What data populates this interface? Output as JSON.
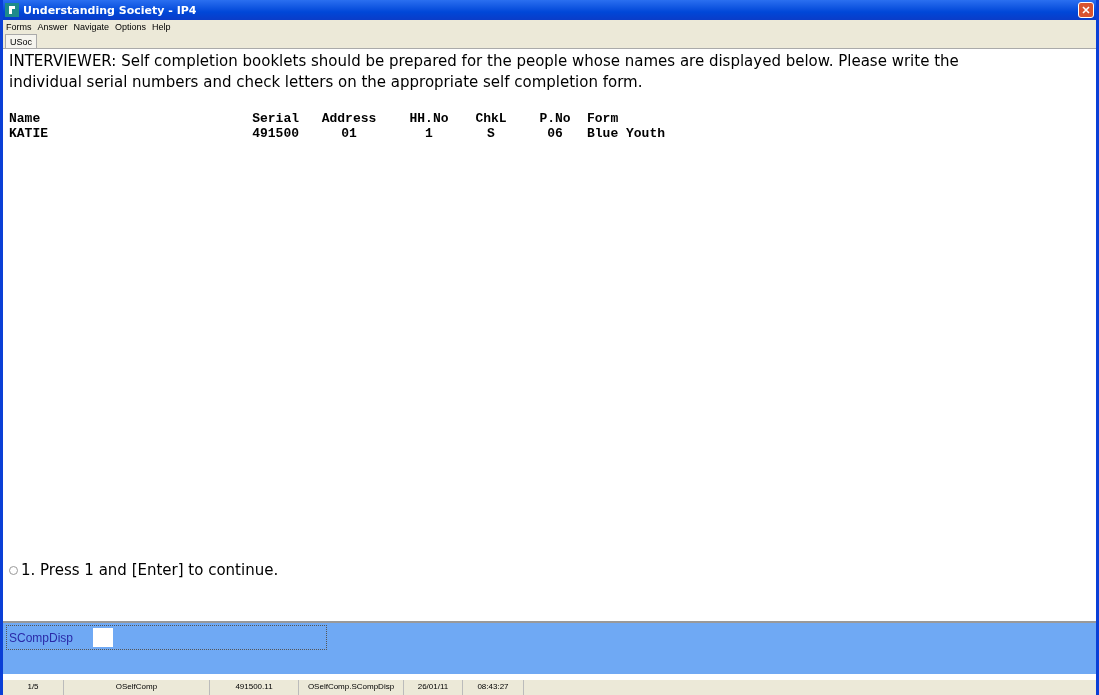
{
  "window": {
    "title": "Understanding Society - IP4"
  },
  "menu": [
    "Forms",
    "Answer",
    "Navigate",
    "Options",
    "Help"
  ],
  "tabs": [
    {
      "label": "USoc",
      "selected": true
    }
  ],
  "instruction": "INTERVIEWER: Self completion booklets should be prepared for the people whose names are displayed below. Please write the individual serial numbers and check letters on the appropriate self completion form.",
  "table": {
    "columns": [
      "Name",
      "Serial",
      "Address",
      "HH.No",
      "ChkL",
      "P.No",
      "Form"
    ],
    "rows": [
      [
        "KATIE",
        "491500",
        "01",
        "1",
        "S",
        "06",
        "Blue Youth"
      ]
    ]
  },
  "options": [
    {
      "label": "1. Press 1 and [Enter] to continue.",
      "selected": false
    }
  ],
  "answer": {
    "label": "SCompDisp"
  },
  "status_bar": [
    "1/5",
    "OSelfComp",
    "491500.11",
    "OSelfComp.SCompDisp",
    "26/01/11",
    "08:43:27"
  ]
}
